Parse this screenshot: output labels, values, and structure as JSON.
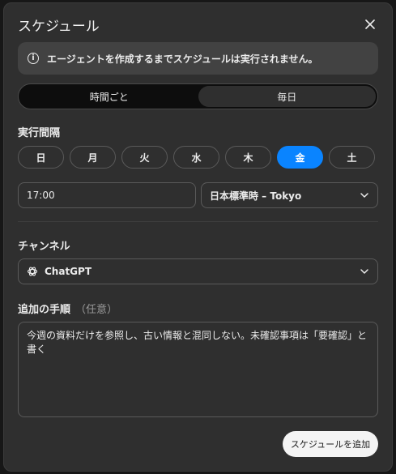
{
  "dialog": {
    "title": "スケジュール",
    "close_icon": "close-icon",
    "info_text": "エージェントを作成するまでスケジュールは実行されません。",
    "info_icon": "info-icon",
    "frequency_tabs": [
      "時間ごと",
      "毎日"
    ],
    "frequency_selected": "毎日",
    "interval_label": "実行間隔",
    "days": [
      "日",
      "月",
      "火",
      "水",
      "木",
      "金",
      "土"
    ],
    "selected_day": "金",
    "time_value": "17:00",
    "timezone_value": "日本標準時 – Tokyo",
    "channel_label": "チャンネル",
    "channel_value": "ChatGPT",
    "channel_icon": "openai-logo-icon",
    "instructions_label": "追加の手順",
    "instructions_optional": "（任意）",
    "instructions_value": "今週の資料だけを参照し、古い情報と混同しない。未確認事項は「要確認」と書く",
    "add_button": "スケジュールを追加"
  },
  "colors": {
    "accent": "#0a84ff",
    "dialog_bg": "#2f2f2f",
    "page_bg": "#171717"
  }
}
